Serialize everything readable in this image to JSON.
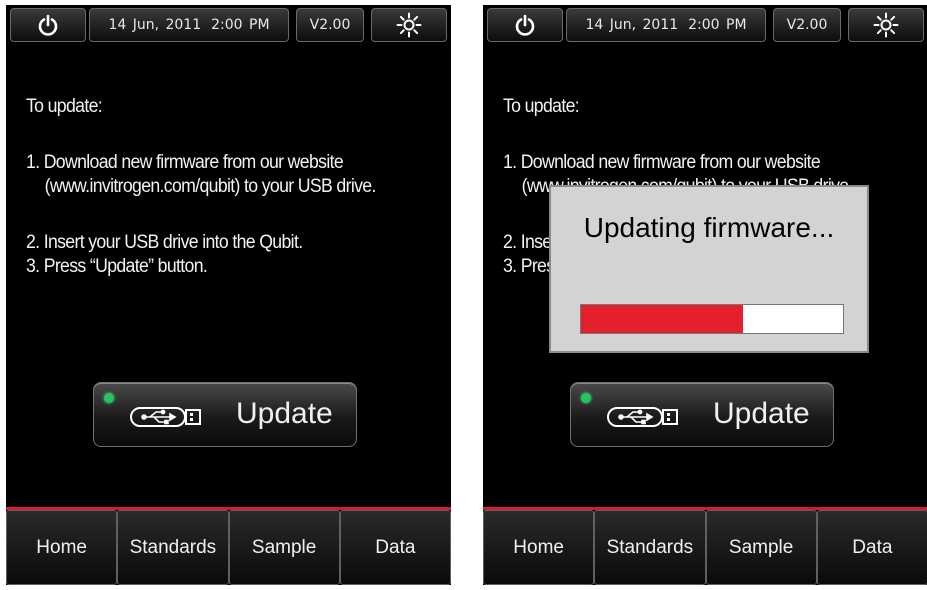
{
  "colors": {
    "screen_bg": "#000000",
    "accent_red": "#d41c2a",
    "led_green": "#22c55e",
    "dialog_bg": "#d3d3d3",
    "progress_red": "#e3202b"
  },
  "topbar": {
    "power_icon": "power-icon",
    "date": "14 Jun, 2011",
    "time": "2:00 PM",
    "version": "V2.00",
    "brightness_icon": "sun-icon"
  },
  "instructions": {
    "intro": "To update:",
    "step1_line1": "1. Download new firmware from our website",
    "step1_line2": "(www.invitrogen.com/qubit) to your USB drive.",
    "step2": "2. Insert your USB drive into the Qubit.",
    "step3": "3. Press “Update” button."
  },
  "update_button": {
    "label": "Update",
    "icon": "usb-icon",
    "led": "green"
  },
  "nav": {
    "home": "Home",
    "standards": "Standards",
    "sample": "Sample",
    "data": "Data"
  },
  "dialog": {
    "title": "Updating firmware...",
    "progress": 0.62
  }
}
